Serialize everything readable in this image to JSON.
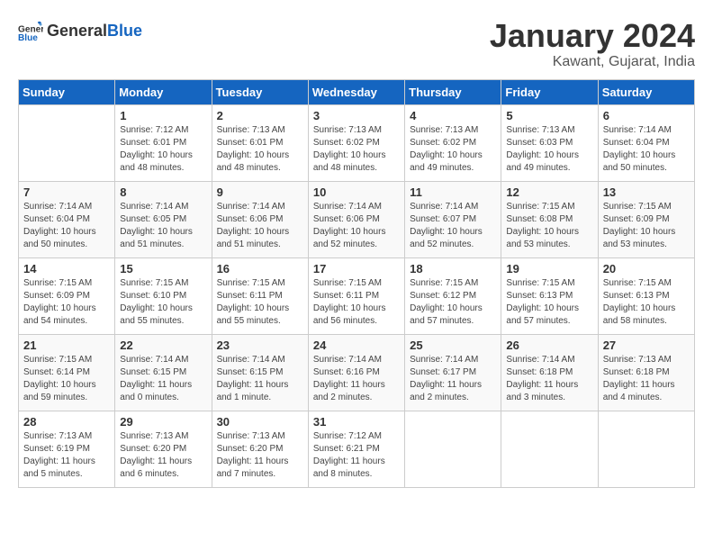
{
  "header": {
    "logo_general": "General",
    "logo_blue": "Blue",
    "month": "January 2024",
    "location": "Kawant, Gujarat, India"
  },
  "columns": [
    "Sunday",
    "Monday",
    "Tuesday",
    "Wednesday",
    "Thursday",
    "Friday",
    "Saturday"
  ],
  "weeks": [
    [
      {
        "day": "",
        "info": ""
      },
      {
        "day": "1",
        "info": "Sunrise: 7:12 AM\nSunset: 6:01 PM\nDaylight: 10 hours\nand 48 minutes."
      },
      {
        "day": "2",
        "info": "Sunrise: 7:13 AM\nSunset: 6:01 PM\nDaylight: 10 hours\nand 48 minutes."
      },
      {
        "day": "3",
        "info": "Sunrise: 7:13 AM\nSunset: 6:02 PM\nDaylight: 10 hours\nand 48 minutes."
      },
      {
        "day": "4",
        "info": "Sunrise: 7:13 AM\nSunset: 6:02 PM\nDaylight: 10 hours\nand 49 minutes."
      },
      {
        "day": "5",
        "info": "Sunrise: 7:13 AM\nSunset: 6:03 PM\nDaylight: 10 hours\nand 49 minutes."
      },
      {
        "day": "6",
        "info": "Sunrise: 7:14 AM\nSunset: 6:04 PM\nDaylight: 10 hours\nand 50 minutes."
      }
    ],
    [
      {
        "day": "7",
        "info": "Sunrise: 7:14 AM\nSunset: 6:04 PM\nDaylight: 10 hours\nand 50 minutes."
      },
      {
        "day": "8",
        "info": "Sunrise: 7:14 AM\nSunset: 6:05 PM\nDaylight: 10 hours\nand 51 minutes."
      },
      {
        "day": "9",
        "info": "Sunrise: 7:14 AM\nSunset: 6:06 PM\nDaylight: 10 hours\nand 51 minutes."
      },
      {
        "day": "10",
        "info": "Sunrise: 7:14 AM\nSunset: 6:06 PM\nDaylight: 10 hours\nand 52 minutes."
      },
      {
        "day": "11",
        "info": "Sunrise: 7:14 AM\nSunset: 6:07 PM\nDaylight: 10 hours\nand 52 minutes."
      },
      {
        "day": "12",
        "info": "Sunrise: 7:15 AM\nSunset: 6:08 PM\nDaylight: 10 hours\nand 53 minutes."
      },
      {
        "day": "13",
        "info": "Sunrise: 7:15 AM\nSunset: 6:09 PM\nDaylight: 10 hours\nand 53 minutes."
      }
    ],
    [
      {
        "day": "14",
        "info": "Sunrise: 7:15 AM\nSunset: 6:09 PM\nDaylight: 10 hours\nand 54 minutes."
      },
      {
        "day": "15",
        "info": "Sunrise: 7:15 AM\nSunset: 6:10 PM\nDaylight: 10 hours\nand 55 minutes."
      },
      {
        "day": "16",
        "info": "Sunrise: 7:15 AM\nSunset: 6:11 PM\nDaylight: 10 hours\nand 55 minutes."
      },
      {
        "day": "17",
        "info": "Sunrise: 7:15 AM\nSunset: 6:11 PM\nDaylight: 10 hours\nand 56 minutes."
      },
      {
        "day": "18",
        "info": "Sunrise: 7:15 AM\nSunset: 6:12 PM\nDaylight: 10 hours\nand 57 minutes."
      },
      {
        "day": "19",
        "info": "Sunrise: 7:15 AM\nSunset: 6:13 PM\nDaylight: 10 hours\nand 57 minutes."
      },
      {
        "day": "20",
        "info": "Sunrise: 7:15 AM\nSunset: 6:13 PM\nDaylight: 10 hours\nand 58 minutes."
      }
    ],
    [
      {
        "day": "21",
        "info": "Sunrise: 7:15 AM\nSunset: 6:14 PM\nDaylight: 10 hours\nand 59 minutes."
      },
      {
        "day": "22",
        "info": "Sunrise: 7:14 AM\nSunset: 6:15 PM\nDaylight: 11 hours\nand 0 minutes."
      },
      {
        "day": "23",
        "info": "Sunrise: 7:14 AM\nSunset: 6:15 PM\nDaylight: 11 hours\nand 1 minute."
      },
      {
        "day": "24",
        "info": "Sunrise: 7:14 AM\nSunset: 6:16 PM\nDaylight: 11 hours\nand 2 minutes."
      },
      {
        "day": "25",
        "info": "Sunrise: 7:14 AM\nSunset: 6:17 PM\nDaylight: 11 hours\nand 2 minutes."
      },
      {
        "day": "26",
        "info": "Sunrise: 7:14 AM\nSunset: 6:18 PM\nDaylight: 11 hours\nand 3 minutes."
      },
      {
        "day": "27",
        "info": "Sunrise: 7:13 AM\nSunset: 6:18 PM\nDaylight: 11 hours\nand 4 minutes."
      }
    ],
    [
      {
        "day": "28",
        "info": "Sunrise: 7:13 AM\nSunset: 6:19 PM\nDaylight: 11 hours\nand 5 minutes."
      },
      {
        "day": "29",
        "info": "Sunrise: 7:13 AM\nSunset: 6:20 PM\nDaylight: 11 hours\nand 6 minutes."
      },
      {
        "day": "30",
        "info": "Sunrise: 7:13 AM\nSunset: 6:20 PM\nDaylight: 11 hours\nand 7 minutes."
      },
      {
        "day": "31",
        "info": "Sunrise: 7:12 AM\nSunset: 6:21 PM\nDaylight: 11 hours\nand 8 minutes."
      },
      {
        "day": "",
        "info": ""
      },
      {
        "day": "",
        "info": ""
      },
      {
        "day": "",
        "info": ""
      }
    ]
  ]
}
